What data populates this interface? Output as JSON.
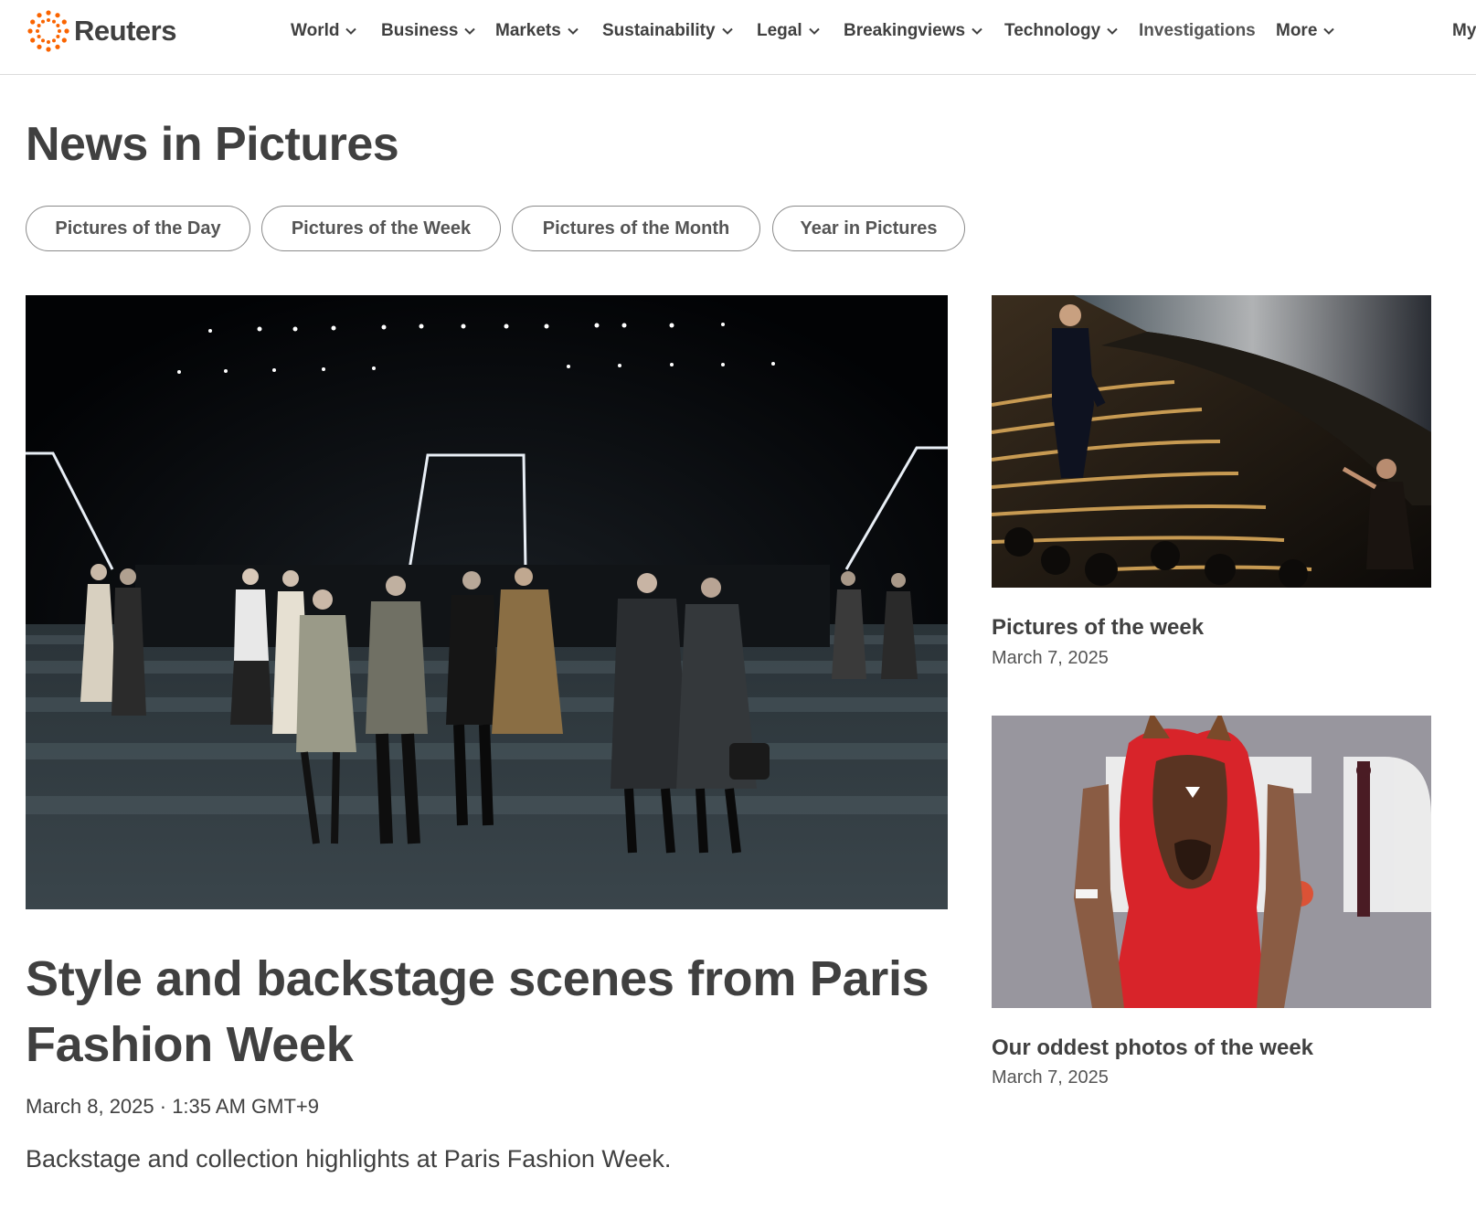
{
  "header": {
    "logo_text": "Reuters",
    "nav": [
      {
        "label": "World"
      },
      {
        "label": "Business"
      },
      {
        "label": "Markets"
      },
      {
        "label": "Sustainability"
      },
      {
        "label": "Legal"
      },
      {
        "label": "Breakingviews"
      },
      {
        "label": "Technology"
      },
      {
        "label": "Investigations"
      },
      {
        "label": "More"
      },
      {
        "label": "My"
      }
    ],
    "brand_color": "#fa6400"
  },
  "page_title": "News in Pictures",
  "pills": [
    {
      "label": "Pictures of the Day"
    },
    {
      "label": "Pictures of the Week"
    },
    {
      "label": "Pictures of the Month"
    },
    {
      "label": "Year in Pictures"
    }
  ],
  "feature": {
    "title": "Style and backstage scenes from Paris Fashion Week",
    "date": "March 8, 2025 · 1:35 AM GMT+9",
    "description": "Backstage and collection highlights at Paris Fashion Week."
  },
  "side_cards": [
    {
      "title": "Pictures of the week",
      "date": "March 7, 2025"
    },
    {
      "title": "Our oddest photos of the week",
      "date": "March 7, 2025"
    }
  ]
}
